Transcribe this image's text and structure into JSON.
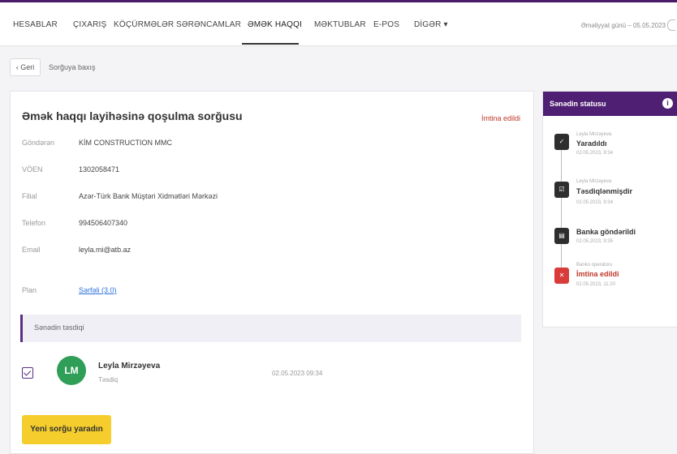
{
  "nav": {
    "items": [
      {
        "label": "HESABLAR"
      },
      {
        "label": "ÇIXARIŞ"
      },
      {
        "label": "KÖÇÜRMƏLƏR"
      },
      {
        "label": "SƏRƏNCAMLAR"
      },
      {
        "label": "ƏMƏK HAQQI"
      },
      {
        "label": "MƏKTUBLAR"
      },
      {
        "label": "E-POS"
      },
      {
        "label": "DİGƏR ▾"
      }
    ],
    "operation_day": "Əməliyyat günü – 05.05.2023"
  },
  "breadcrumb": {
    "back_label": "‹ Geri",
    "current": "Sorğuya baxış"
  },
  "request": {
    "title": "Əmək haqqı layihəsinə qoşulma sorğusu",
    "status": "İmtina edildi",
    "fields": {
      "sender": {
        "label": "Göndərən",
        "value": "KİM CONSTRUCTION MMC"
      },
      "voen": {
        "label": "VÖEN",
        "value": "1302058471"
      },
      "branch": {
        "label": "Filial",
        "value": "Azər-Türk Bank Müştəri Xidmətləri Mərkəzi"
      },
      "phone": {
        "label": "Telefon",
        "value": "994506407340"
      },
      "email": {
        "label": "Email",
        "value": "leyla.mi@atb.az"
      },
      "plan": {
        "label": "Plan",
        "value": "Sərfəli (3.0)"
      }
    },
    "confirmation": {
      "heading": "Sənədin təsdiqi",
      "signer_initials": "LM",
      "signer_name": "Leyla Mirzəyeva",
      "signer_role": "Təsdiq",
      "signed_at": "02.05.2023 09:34"
    },
    "new_request_label": "Yeni sorğu yaradın"
  },
  "status_panel": {
    "title": "Sənədin statusu",
    "info_glyph": "i",
    "steps": [
      {
        "actor": "Leyla Mirzəyeva",
        "status": "Yaradıldı",
        "date": "02.05.2023, 9:34",
        "icon": "pen-icon",
        "glyph": "✓"
      },
      {
        "actor": "Leyla Mirzəyeva",
        "status": "Təsdiqlənmişdir",
        "date": "02.05.2023, 9:34",
        "icon": "approve-icon",
        "glyph": "☑"
      },
      {
        "actor": "",
        "status": "Banka göndərildi",
        "date": "02.05.2023, 9:35",
        "icon": "bank-icon",
        "glyph": "▤"
      },
      {
        "actor": "Banko operatoru",
        "status": "İmtina edildi",
        "date": "02.05.2023, 11:20",
        "icon": "reject-icon",
        "glyph": "✕"
      }
    ]
  },
  "colors": {
    "brand_purple": "#4e1f72",
    "accent_yellow": "#f5cd2c",
    "reject_red": "#c0392b",
    "avatar_green": "#2f9e57"
  }
}
